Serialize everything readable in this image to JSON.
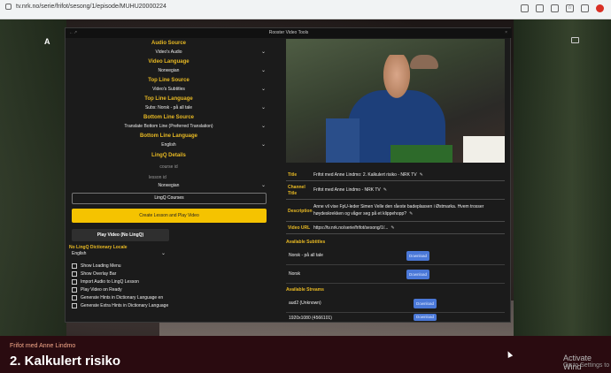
{
  "browser": {
    "url": "tv.nrk.no/serie/frifot/sesong/1/episode/MUHU20000224"
  },
  "player": {
    "logo": "A",
    "episode_series": "Frifot med Anne Lindmo",
    "episode_title": "2. Kalkulert risiko",
    "watermark_line1": "Activate Wind",
    "watermark_line2": "Go to Settings to"
  },
  "panel": {
    "title": "Rooster Video Tools",
    "left_corner": "←↗",
    "right_corner": "×",
    "audio_source_h": "Audio Source",
    "audio_source_v": "Video's Audio",
    "video_language_h": "Video Language",
    "video_language_v": "Norwegian",
    "top_line_source_h": "Top Line Source",
    "top_line_source_v": "Video's Subtitles",
    "top_line_language_h": "Top Line Language",
    "top_line_language_v": "Subs: Norsk - på all tale",
    "bottom_line_source_h": "Bottom Line Source",
    "bottom_line_source_v": "Translate Bottom Line (Preferred Translation)",
    "bottom_line_language_h": "Bottom Line Language",
    "bottom_line_language_v": "English",
    "lingq_details_h": "LingQ Details",
    "course_id_placeholder": "course id",
    "lesson_id_placeholder": "lesson id",
    "lingq_language_v": "Norwegian",
    "lingq_courses_btn": "LingQ Courses",
    "create_lesson_btn": "Create Lesson and Play Video",
    "play_video_btn": "Play Video (No LingQ)",
    "no_lingq_locale_h": "No LingQ Dictionary Locale",
    "no_lingq_locale_v": "English",
    "checkboxes": [
      "Show Loading Menu",
      "Show Overlay Bar",
      "Import Audio to LingQ Lesson",
      "Play Video on Ready",
      "Generate Hints in Dictionary Language en",
      "Generate Extra Hints in Dictionary Language"
    ],
    "info": {
      "title_l": "Title",
      "title_v": "Frifot med Anne Lindmo: 2. Kalkulert risiko - NRK TV",
      "channel_l": "Channel Title",
      "channel_v": "Frifot med Anne Lindmo - NRK TV",
      "desc_l": "Description",
      "desc_v": "Anne vil vise FpU-leder Simen Velle den råeste badeplassen i Østmarka. Hvem trosser høydeskrekken og våger seg på et klippehopp?",
      "url_l": "Video URL",
      "url_v": "https://tv.nrk.no/serie/frifot/sesong/1/..."
    },
    "subtitles_h": "Available Subtitles",
    "subtitles": [
      {
        "name": "Norsk - på all tale",
        "btn": "Download"
      },
      {
        "name": "Norsk",
        "btn": "Download"
      }
    ],
    "streams_h": "Available Streams",
    "streams": [
      {
        "name": "aud2 (Unknown)",
        "btn": "Download"
      },
      {
        "name": "1920x1080 (4566101)",
        "btn": "Download"
      }
    ],
    "edit_glyph": "✎"
  },
  "colors": {
    "accent": "#e8b923",
    "yellow_button": "#f5c300",
    "download_button": "#4a78d8"
  }
}
